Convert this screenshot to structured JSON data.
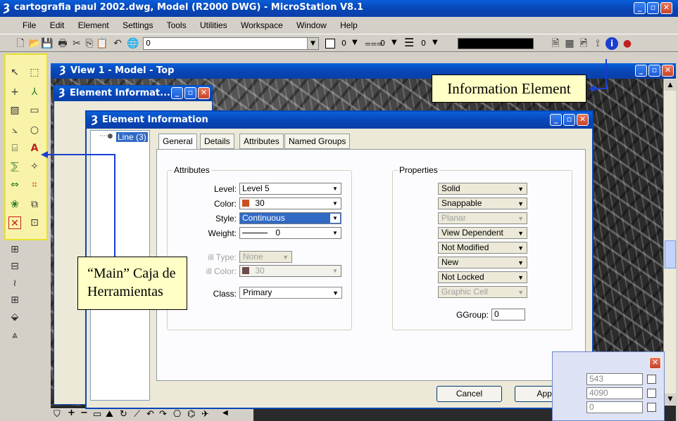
{
  "app": {
    "title": "cartografia paul 2002.dwg, Model (R2000 DWG) - MicroStation V8.1"
  },
  "menu": {
    "items": [
      "File",
      "Edit",
      "Element",
      "Settings",
      "Tools",
      "Utilities",
      "Workspace",
      "Window",
      "Help"
    ]
  },
  "toolbar": {
    "level_value": "0",
    "color_value": "0",
    "style_value": "0",
    "weight_value": "0"
  },
  "view_window": {
    "title": "View 1 - Model - Top"
  },
  "small_window": {
    "title": "Element Informat..."
  },
  "dialog": {
    "title": "Element Information",
    "tree_item": "Line (3)",
    "tabs": [
      "General",
      "Details",
      "Attributes",
      "Named Groups"
    ],
    "attributes": {
      "group_label": "Attributes",
      "level_label": "Level:",
      "level_value": "Level 5",
      "color_label": "Color:",
      "color_value": "30",
      "style_label": "Style:",
      "style_value": "Continuous",
      "weight_label": "Weight:",
      "weight_value": "0",
      "fill_type_label": "ill Type:",
      "fill_type_value": "None",
      "fill_color_label": "ill Color:",
      "fill_color_value": "30",
      "class_label": "Class:",
      "class_value": "Primary"
    },
    "properties": {
      "group_label": "Properties",
      "items": [
        "Solid",
        "Snappable",
        "Planar",
        "View Dependent",
        "Not Modified",
        "New",
        "Not Locked",
        "Graphic Cell"
      ],
      "ggroup_label": "GGroup:",
      "ggroup_value": "0"
    },
    "cancel_label": "Cancel",
    "apply_label": "Apply"
  },
  "annotations": {
    "info_element": "Information Element",
    "main_toolbox_line1": "“Main” Caja de",
    "main_toolbox_line2": "Herramientas"
  },
  "coord_panel": {
    "values": [
      "543",
      "4090",
      "0"
    ]
  },
  "colors": {
    "title_bar": "#0846b7",
    "element_color": "#c8501e",
    "selection": "#316ac5",
    "note_bg": "#ffffc6",
    "highlight_border": "#e8e030",
    "arrow": "#1a3fd0"
  }
}
